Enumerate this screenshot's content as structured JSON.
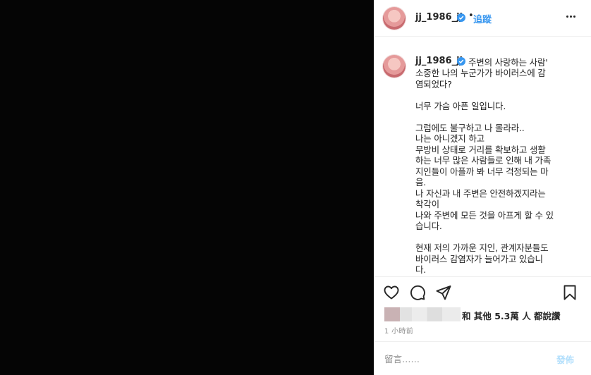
{
  "post": {
    "username": "jj_1986_jj",
    "follow_label": "追蹤",
    "separator": "•",
    "caption_first_line": "주변의 사랑하는 사람'",
    "caption_lines": [
      "소중한 나의 누군가가 바이러스에 감",
      "염되었다?",
      "",
      "너무 가슴 아픈 일입니다.",
      "",
      "그럼에도 불구하고 나 몰라라..",
      "나는 아니겠지 하고",
      "무방비 상태로 거리를 확보하고 생활",
      "하는 너무 많은 사람들로 인해 내 가족",
      "지인들이 아플까 봐 너무 걱정되는 마",
      "음.",
      "나 자신과 내 주변은 안전하겠지라는",
      "착각이",
      "나와 주변에 모든 것을 아프게 할 수 있",
      "습니다.",
      "",
      "현재 저의 가까운 지인, 관계자분들도",
      "바이러스 감염자가 늘어가고 있습니",
      "다."
    ],
    "likes_text": "和 其他 5.3萬 人 都說讚",
    "timestamp": "1 小時前"
  },
  "comment": {
    "placeholder": "留言……",
    "post_label": "發佈"
  },
  "icons": [
    "more-options-icon",
    "verified-badge-icon",
    "heart-icon",
    "comment-icon",
    "share-icon",
    "bookmark-icon"
  ],
  "colors": {
    "accent": "#3897f0",
    "post_disabled": "#b2dffc",
    "muted": "#8e8e8e",
    "media_background": "#050505"
  }
}
